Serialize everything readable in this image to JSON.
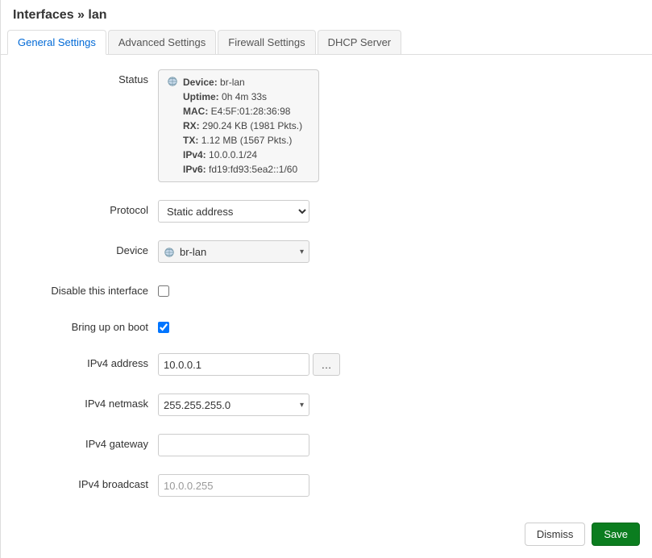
{
  "header": {
    "title": "Interfaces » lan"
  },
  "tabs": [
    {
      "label": "General Settings",
      "active": true
    },
    {
      "label": "Advanced Settings",
      "active": false
    },
    {
      "label": "Firewall Settings",
      "active": false
    },
    {
      "label": "DHCP Server",
      "active": false
    }
  ],
  "labels": {
    "status": "Status",
    "protocol": "Protocol",
    "device": "Device",
    "disable": "Disable this interface",
    "bring_up": "Bring up on boot",
    "ipv4_addr": "IPv4 address",
    "ipv4_netmask": "IPv4 netmask",
    "ipv4_gateway": "IPv4 gateway",
    "ipv4_broadcast": "IPv4 broadcast"
  },
  "status": {
    "device_label": "Device:",
    "device_value": "br-lan",
    "uptime_label": "Uptime:",
    "uptime_value": "0h 4m 33s",
    "mac_label": "MAC:",
    "mac_value": "E4:5F:01:28:36:98",
    "rx_label": "RX:",
    "rx_value": "290.24 KB (1981 Pkts.)",
    "tx_label": "TX:",
    "tx_value": "1.12 MB (1567 Pkts.)",
    "ipv4_label": "IPv4:",
    "ipv4_value": "10.0.0.1/24",
    "ipv6_label": "IPv6:",
    "ipv6_value": "fd19:fd93:5ea2::1/60"
  },
  "fields": {
    "protocol": {
      "value": "Static address"
    },
    "device": {
      "value": "br-lan"
    },
    "disable": {
      "checked": false
    },
    "bring_up": {
      "checked": true
    },
    "ipv4_addr": {
      "value": "10.0.0.1"
    },
    "ipv4_addr_btn": "…",
    "ipv4_netmask": {
      "value": "255.255.255.0"
    },
    "ipv4_gateway": {
      "value": ""
    },
    "ipv4_broadcast": {
      "value": "",
      "placeholder": "10.0.0.255"
    }
  },
  "footer": {
    "dismiss": "Dismiss",
    "save": "Save"
  }
}
